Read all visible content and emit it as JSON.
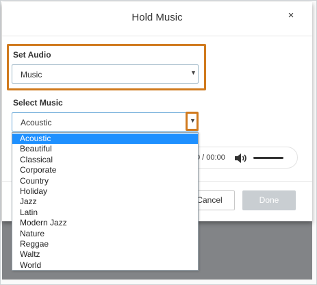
{
  "dialog": {
    "title": "Hold Music",
    "close_glyph": "×"
  },
  "set_audio": {
    "label": "Set Audio",
    "selected_value": "Music",
    "arrow_glyph": "▼"
  },
  "select_music": {
    "label": "Select Music",
    "selected_value": "Acoustic",
    "arrow_glyph": "▼",
    "options": [
      "Acoustic",
      "Beautiful",
      "Classical",
      "Corporate",
      "Country",
      "Holiday",
      "Jazz",
      "Latin",
      "Modern Jazz",
      "Nature",
      "Reggae",
      "Waltz",
      "World"
    ],
    "highlighted_option": "Acoustic"
  },
  "player": {
    "time_text": "0 / 00:00",
    "volume_icon": "speaker-volume-icon"
  },
  "footer": {
    "cancel_label": "Cancel",
    "done_label": "Done"
  },
  "colors": {
    "highlight_box": "#d07a1e",
    "selected_option": "#1e90ff",
    "done_button_bg": "#c9ced2",
    "backdrop": "#828487"
  }
}
